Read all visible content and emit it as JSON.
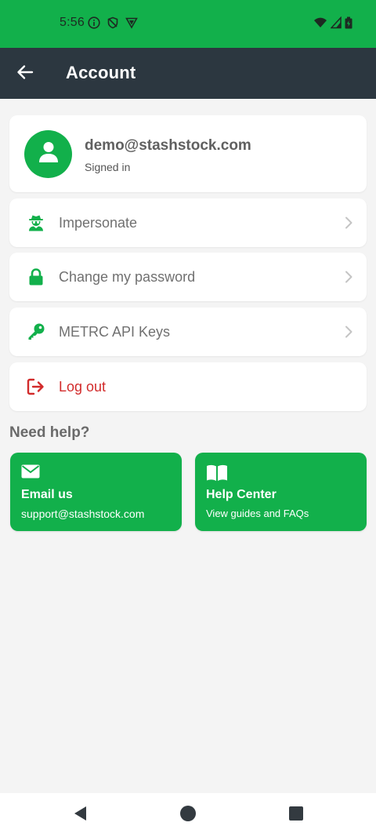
{
  "status_bar": {
    "time": "5:56",
    "left_icons": [
      "info-icon",
      "shield-icon",
      "vpn-icon"
    ],
    "right_icons": [
      "wifi-icon",
      "signal-icon",
      "battery-icon"
    ]
  },
  "app_bar": {
    "title": "Account",
    "back_icon": "arrow-left-icon"
  },
  "profile": {
    "email": "demo@stashstock.com",
    "status": "Signed in",
    "icon": "user-icon"
  },
  "menu": [
    {
      "label": "Impersonate",
      "icon": "user-secret-icon"
    },
    {
      "label": "Change my password",
      "icon": "lock-icon"
    },
    {
      "label": "METRC API Keys",
      "icon": "key-icon"
    },
    {
      "label": "Log out",
      "icon": "sign-out-icon"
    }
  ],
  "help": {
    "heading": "Need help?",
    "cards": [
      {
        "title": "Email us",
        "subtitle": "support@stashstock.com",
        "icon": "envelope-icon"
      },
      {
        "title": "Help Center",
        "subtitle": "View guides and FAQs",
        "icon": "book-open-icon"
      }
    ]
  },
  "colors": {
    "brand_green": "#12b04b",
    "app_bar": "#2c3740",
    "danger": "#d22b2b",
    "background": "#f4f4f4"
  }
}
